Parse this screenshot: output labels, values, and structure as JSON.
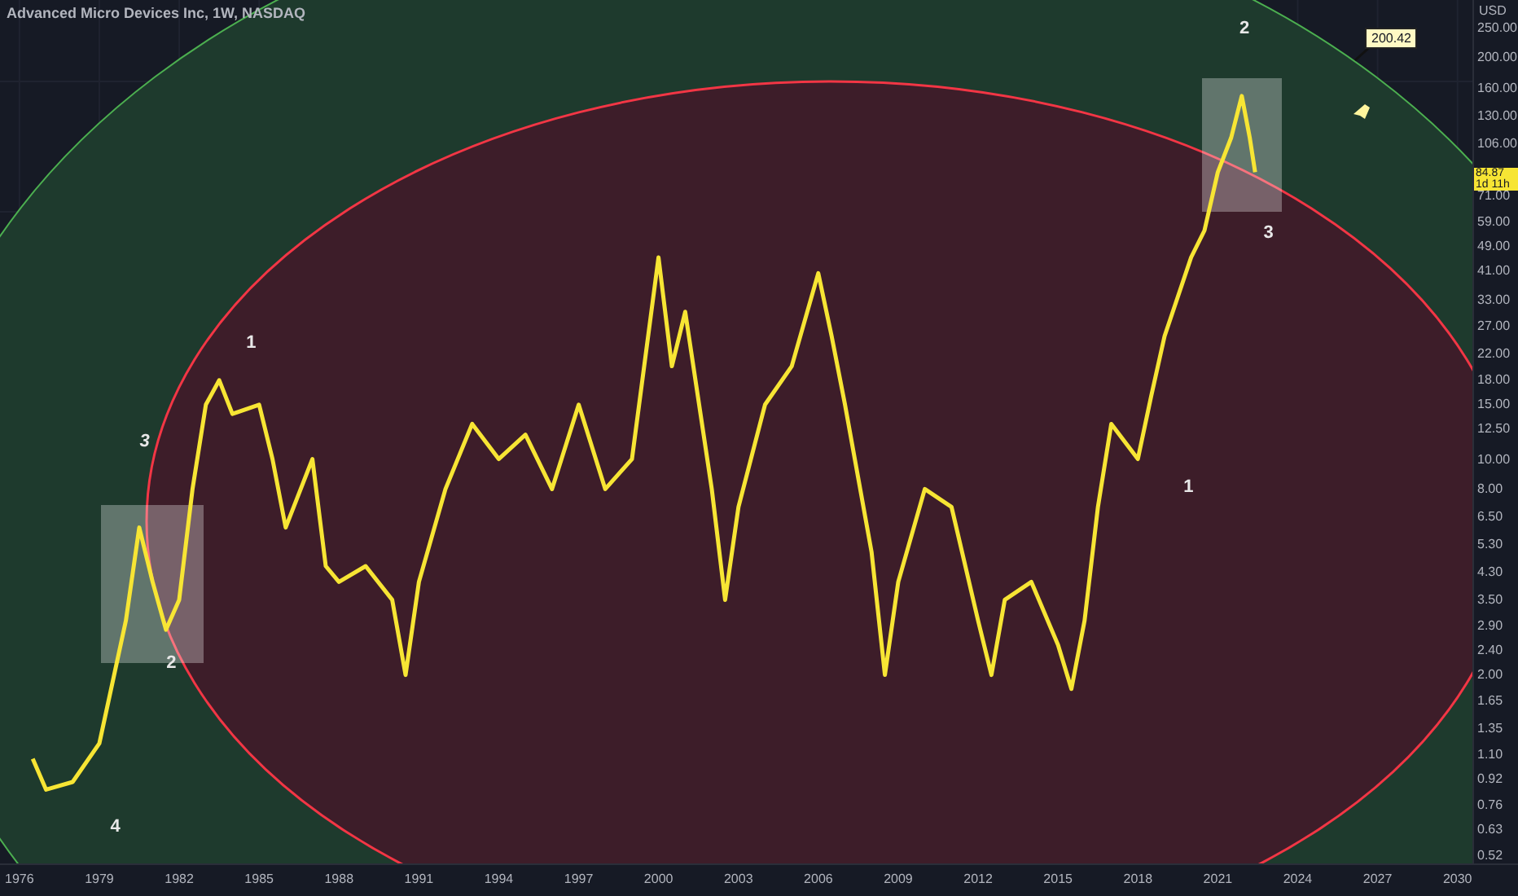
{
  "chart": {
    "title": "Advanced Micro Devices Inc, 1W, NASDAQ",
    "currency": "USD",
    "last_price": {
      "value": "84.87",
      "countdown": "1d 11h"
    },
    "callout": {
      "text": "200.42"
    },
    "wave_labels": [
      "4",
      "3",
      "2",
      "1",
      "1",
      "2",
      "3"
    ],
    "price_axis_labels": [
      "250.00",
      "200.00",
      "160.00",
      "130.00",
      "106.00",
      "71.00",
      "59.00",
      "49.00",
      "41.00",
      "33.00",
      "27.00",
      "22.00",
      "18.00",
      "15.00",
      "12.50",
      "10.00",
      "8.00",
      "6.50",
      "5.30",
      "4.30",
      "3.50",
      "2.90",
      "2.40",
      "2.00",
      "1.65",
      "1.35",
      "1.10",
      "0.92",
      "0.76",
      "0.63",
      "0.52"
    ],
    "time_axis_labels": [
      "1976",
      "1979",
      "1982",
      "1985",
      "1988",
      "1991",
      "1994",
      "1997",
      "2000",
      "2003",
      "2006",
      "2009",
      "2012",
      "2015",
      "2018",
      "2021",
      "2024",
      "2027",
      "2030"
    ]
  }
}
